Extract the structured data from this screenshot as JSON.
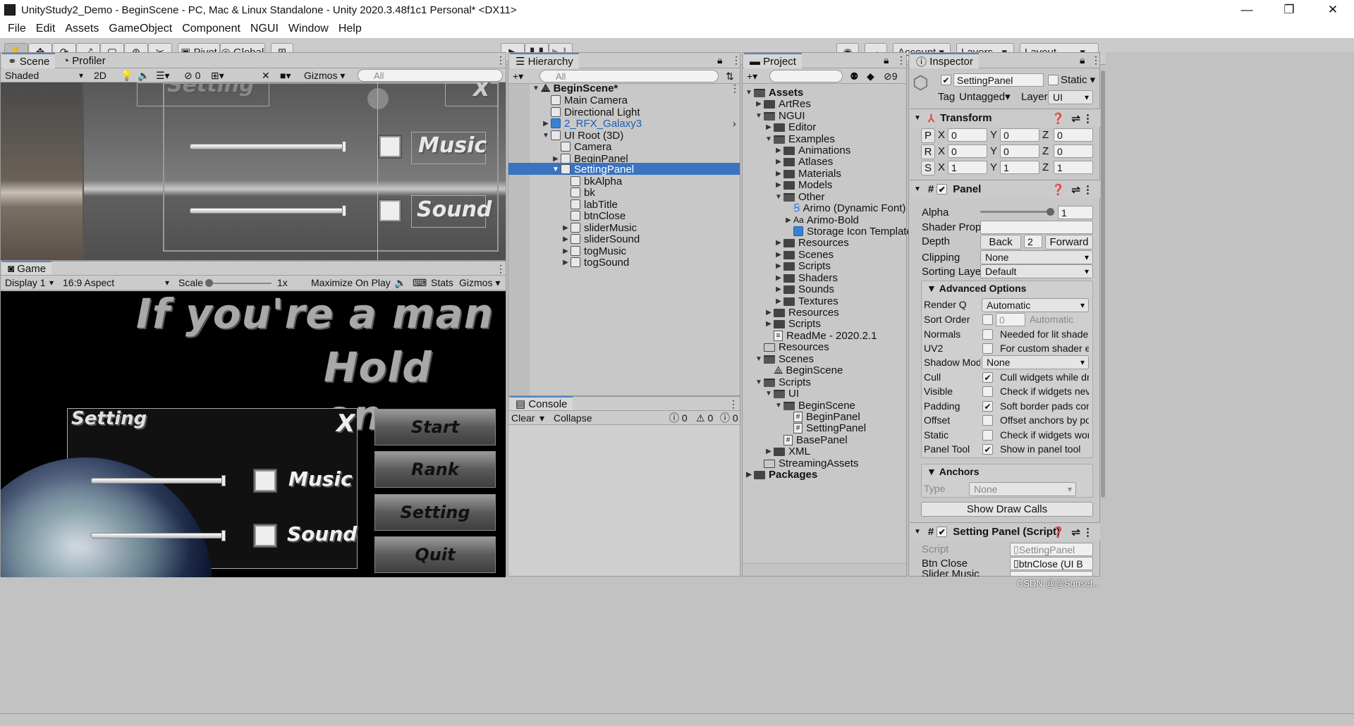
{
  "window": {
    "title": "UnityStudy2_Demo - BeginScene - PC, Mac & Linux Standalone - Unity 2020.3.48f1c1 Personal* <DX11>"
  },
  "menu": [
    "File",
    "Edit",
    "Assets",
    "GameObject",
    "Component",
    "NGUI",
    "Window",
    "Help"
  ],
  "toolbar": {
    "pivot": "Pivot",
    "global": "Global",
    "account": "Account",
    "layers": "Layers",
    "layout": "Layout"
  },
  "scene": {
    "tab_scene": "Scene",
    "tab_profiler": "Profiler",
    "shading": "Shaded",
    "mode2d": "2D",
    "hidden_count": "0",
    "gizmos": "Gizmos",
    "search": "All",
    "music": "Music",
    "sound": "Sound",
    "setting_title": "Setting"
  },
  "game": {
    "tab": "Game",
    "display": "Display 1",
    "aspect": "16:9 Aspect",
    "scale_label": "Scale",
    "scale_value": "1x",
    "maximize": "Maximize On Play",
    "stats": "Stats",
    "gizmos": "Gizmos",
    "line1": "If you're a man",
    "line2": "Hold on",
    "setting_title": "Setting",
    "close": "X",
    "music": "Music",
    "sound": "Sound",
    "buttons": [
      "Start",
      "Rank",
      "Setting",
      "Quit"
    ]
  },
  "hierarchy": {
    "tab": "Hierarchy",
    "search": "All",
    "items": [
      "BeginScene*",
      "Main Camera",
      "Directional Light",
      "2_RFX_Galaxy3",
      "UI Root (3D)",
      "Camera",
      "BeginPanel",
      "SettingPanel",
      "bkAlpha",
      "bk",
      "labTitle",
      "btnClose",
      "sliderMusic",
      "sliderSound",
      "togMusic",
      "togSound"
    ]
  },
  "console": {
    "tab": "Console",
    "clear": "Clear",
    "collapse": "Collapse",
    "counts": [
      "0",
      "0",
      "0"
    ]
  },
  "project": {
    "tab": "Project",
    "hidden": "9",
    "items": [
      "Assets",
      "ArtRes",
      "NGUI",
      "Editor",
      "Examples",
      "Animations",
      "Atlases",
      "Materials",
      "Models",
      "Other",
      "Arimo (Dynamic Font)",
      "Arimo-Bold",
      "Storage Icon Template",
      "Resources",
      "Scenes",
      "Scripts",
      "Shaders",
      "Sounds",
      "Textures",
      "Resources",
      "Scripts",
      "ReadMe - 2020.2.1",
      "Resources",
      "Scenes",
      "BeginScene",
      "Scripts",
      "UI",
      "BeginScene",
      "BeginPanel",
      "SettingPanel",
      "BasePanel",
      "XML",
      "StreamingAssets",
      "Packages"
    ]
  },
  "inspector": {
    "tab": "Inspector",
    "name": "SettingPanel",
    "static": "Static",
    "tag_label": "Tag",
    "tag": "Untagged",
    "layer_label": "Layer",
    "layer": "UI",
    "transform": "Transform",
    "p": [
      "0",
      "0",
      "0"
    ],
    "r": [
      "0",
      "0",
      "0"
    ],
    "s": [
      "1",
      "1",
      "1"
    ],
    "panel": "Panel",
    "alpha_label": "Alpha",
    "alpha": "1",
    "alpha_fraction": 1.0,
    "shader_label": "Shader Prop.",
    "depth_label": "Depth",
    "back": "Back",
    "depth": "2",
    "forward": "Forward",
    "clipping_label": "Clipping",
    "clipping": "None",
    "sorting_label": "Sorting Layer",
    "sorting": "Default",
    "advanced": "Advanced Options",
    "renderq_label": "Render Q",
    "renderq": "Automatic",
    "sortorder_label": "Sort Order",
    "sortorder": "0",
    "sortorder_hint": "Automatic",
    "normals_label": "Normals",
    "normals_hint": "Needed for lit shaders",
    "uv2_label": "UV2",
    "uv2_hint": "For custom shader ef",
    "shadow_label": "Shadow Mode",
    "shadow": "None",
    "cull_label": "Cull",
    "cull_hint": "Cull widgets while dr",
    "visible_label": "Visible",
    "visible_hint": "Check if widgets nev",
    "padding_label": "Padding",
    "padding_hint": "Soft border pads cont",
    "offset_label": "Offset",
    "offset_hint": "Offset anchors by pos",
    "static_label": "Static",
    "static_hint": "Check if widgets wor",
    "paneltool_label": "Panel Tool",
    "paneltool_hint": "Show in panel tool",
    "anchors": "Anchors",
    "type_label": "Type",
    "type": "None",
    "draw_calls": "Show Draw Calls",
    "script_comp": "Setting Panel (Script)",
    "script_label": "Script",
    "script": "SettingPanel",
    "btnclose_label": "Btn Close",
    "btnclose": "btnClose (UI B",
    "slidermusic_label": "Slider Music",
    "slidermusic": "sliderMusic (UI"
  },
  "watermark": "CSDN @@Sunset..."
}
